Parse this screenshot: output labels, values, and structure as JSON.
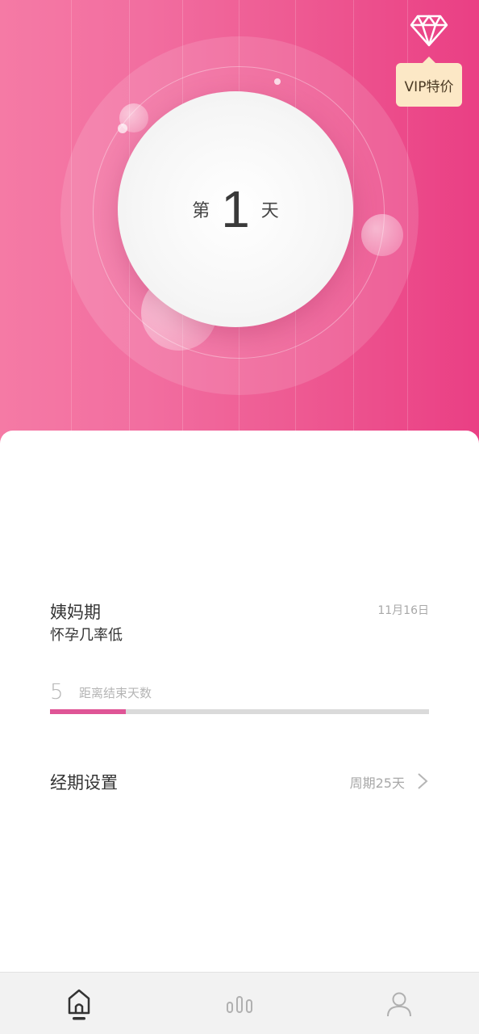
{
  "vip": {
    "label": "VIP特价",
    "icon": "diamond-icon"
  },
  "hero": {
    "prefix": "第",
    "day_number": "1",
    "suffix": "天"
  },
  "phase": {
    "title": "姨妈期",
    "date": "11月16日",
    "subtitle": "怀孕几率低"
  },
  "countdown": {
    "days": "5",
    "label": "距离结束天数",
    "progress_fraction": 0.2
  },
  "settings": {
    "label": "经期设置",
    "value": "周期25天",
    "icon": "chevron-right-icon"
  },
  "bottom_nav": {
    "items": [
      {
        "name": "home",
        "icon": "home-icon",
        "active": true
      },
      {
        "name": "stats",
        "icon": "bar-chart-icon",
        "active": false
      },
      {
        "name": "profile",
        "icon": "user-icon",
        "active": false
      }
    ]
  },
  "colors": {
    "hero_gradient_start": "#f57aa5",
    "hero_gradient_end": "#ea3f84",
    "progress_fill": "#df5596",
    "vip_bg": "#fce8c6"
  }
}
